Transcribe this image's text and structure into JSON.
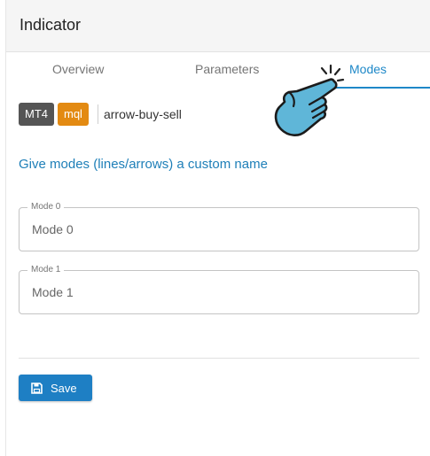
{
  "header": {
    "title": "Indicator"
  },
  "tabs": [
    {
      "label": "Overview",
      "active": false
    },
    {
      "label": "Parameters",
      "active": false
    },
    {
      "label": "Modes",
      "active": true
    }
  ],
  "indicator": {
    "platform_badge": "MT4",
    "language_badge": "mql",
    "name": "arrow-buy-sell"
  },
  "section": {
    "title": "Give modes (lines/arrows) a custom name"
  },
  "modes": [
    {
      "label": "Mode 0",
      "placeholder": "Mode 0"
    },
    {
      "label": "Mode 1",
      "placeholder": "Mode 1"
    }
  ],
  "actions": {
    "save_label": "Save"
  },
  "colors": {
    "accent": "#1e88c8",
    "save_button": "#1e7fc4",
    "mt4_badge": "#555555",
    "mql_badge": "#e38a12",
    "pointer_hand": "#5fb6d8"
  },
  "icons": {
    "save": "floppy-disk-icon",
    "pointer": "pointing-hand-icon"
  }
}
